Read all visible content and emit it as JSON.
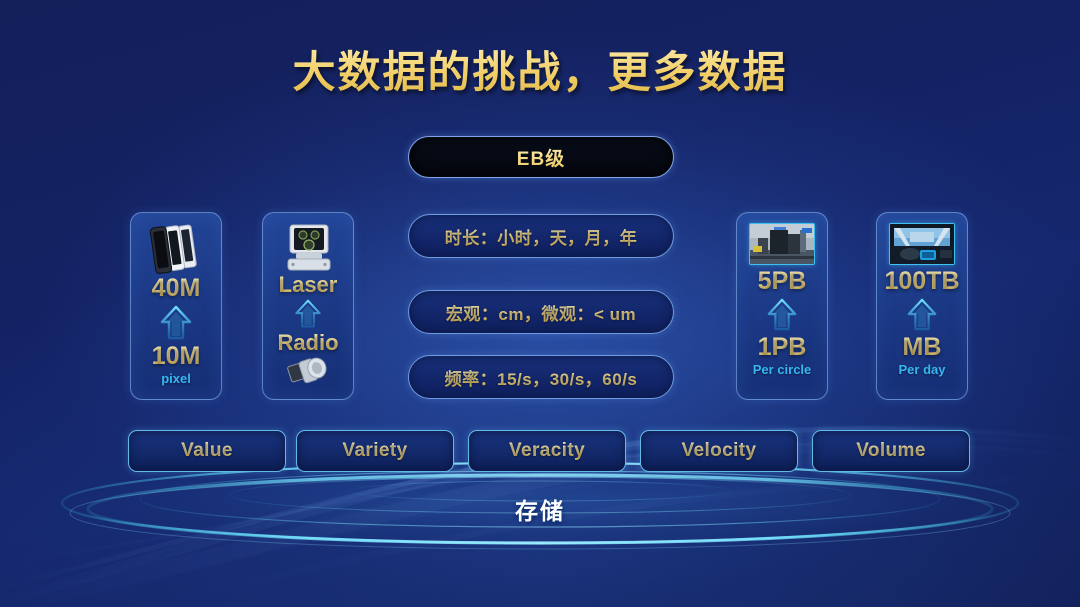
{
  "slide": {
    "title": "大数据的挑战，更多数据",
    "badge": {
      "label": "EB级"
    },
    "storage_label": "存储",
    "colors": {
      "background": "#13205a",
      "gold": "#f0c95e",
      "cyan": "#36b6f0",
      "pill_border": "#6d9ce0",
      "card_border": "#82afeb"
    }
  },
  "cards": [
    {
      "id": "card-40m",
      "icon": "smartphones-icon",
      "top_value": "40M",
      "bottom_value": "10M",
      "unit": "pixel",
      "arrow": "up-arrow-icon"
    },
    {
      "id": "card-laser",
      "icon": "lidar-icon",
      "top_value": "Laser",
      "bottom_value": "Radio",
      "unit": "",
      "bottom_icon": "radar-sensor-icon",
      "arrow": "up-arrow-icon"
    },
    {
      "id": "card-5pb",
      "icon": "industrial-photo",
      "top_value": "5PB",
      "bottom_value": "1PB",
      "unit": "Per circle",
      "arrow": "up-arrow-icon"
    },
    {
      "id": "card-100tb",
      "icon": "car-interior-photo",
      "top_value": "100TB",
      "bottom_value": "MB",
      "unit": "Per day",
      "arrow": "up-arrow-icon"
    }
  ],
  "center_pills": [
    {
      "id": "mid-pill-0",
      "label": "时长：小时，天，月，年"
    },
    {
      "id": "mid-pill-1",
      "label": "宏观：cm，微观：< um"
    },
    {
      "id": "mid-pill-2",
      "label": "频率：15/s，30/s，60/s"
    }
  ],
  "v_pills": [
    {
      "id": "v-pill-value",
      "label": "Value"
    },
    {
      "id": "v-pill-variety",
      "label": "Variety"
    },
    {
      "id": "v-pill-veracity",
      "label": "Veracity"
    },
    {
      "id": "v-pill-velocity",
      "label": "Velocity"
    },
    {
      "id": "v-pill-volume",
      "label": "Volume"
    }
  ]
}
